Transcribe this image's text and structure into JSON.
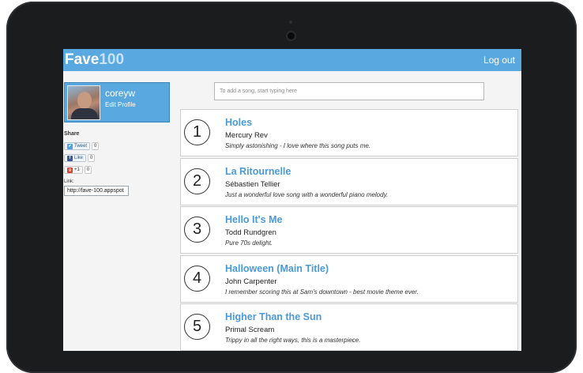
{
  "app": {
    "logo_text": "Fave",
    "logo_num": "100",
    "logout_label": "Log out"
  },
  "profile": {
    "username": "coreyw",
    "edit_label": "Edit Profile"
  },
  "share": {
    "label": "Share",
    "tweet_label": "Tweet",
    "tweet_count": "0",
    "like_label": "Like",
    "like_count": "0",
    "plus_label": "+1",
    "plus_count": "0",
    "link_label": "Link:",
    "link_value": "http://fave-100.appspot"
  },
  "search": {
    "placeholder": "To add a song, start typing here"
  },
  "songs": [
    {
      "rank": "1",
      "title": "Holes",
      "artist": "Mercury Rev",
      "note": "Simply astonishing - I love where this song puts me."
    },
    {
      "rank": "2",
      "title": "La Ritournelle",
      "artist": "Sébastien Tellier",
      "note": "Just a wonderful love song with a wonderful piano melody."
    },
    {
      "rank": "3",
      "title": "Hello It's Me",
      "artist": "Todd Rundgren",
      "note": "Pure 70s delight."
    },
    {
      "rank": "4",
      "title": "Halloween (Main Title)",
      "artist": "John Carpenter",
      "note": "I remember scoring this at Sam's downtown - best movie theme ever."
    },
    {
      "rank": "5",
      "title": "Higher Than the Sun",
      "artist": "Primal Scream",
      "note": "Trippy in all the right ways, this is a masterpiece."
    }
  ],
  "colors": {
    "accent": "#5aa8e0",
    "title": "#4a9ad8",
    "bezel": "#1b1c1e"
  }
}
